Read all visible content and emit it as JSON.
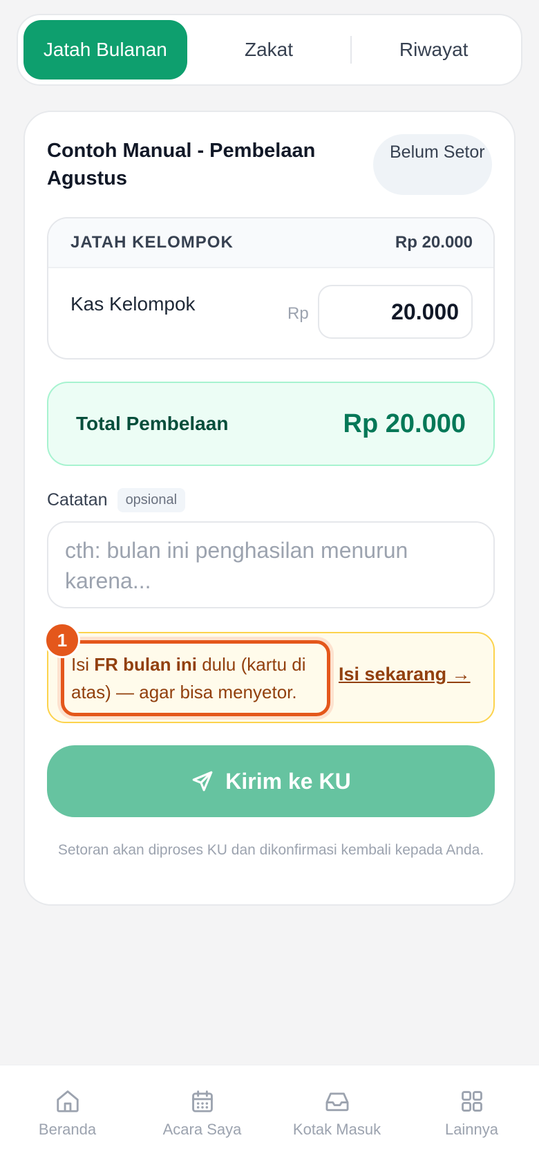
{
  "tabs": [
    {
      "label": "Jatah Bulanan",
      "active": true
    },
    {
      "label": "Zakat",
      "active": false
    },
    {
      "label": "Riwayat",
      "active": false
    }
  ],
  "card": {
    "title": "Contoh Manual - Pembelaan Agustus",
    "status": "Belum Setor",
    "group": {
      "header": "JATAH KELOMPOK",
      "header_amount": "Rp 20.000",
      "row_label": "Kas Kelompok",
      "currency": "Rp",
      "amount_value": "20.000"
    },
    "total": {
      "label": "Total Pembelaan",
      "value": "Rp 20.000"
    },
    "note": {
      "label": "Catatan",
      "optional": "opsional",
      "placeholder": "cth: bulan ini penghasilan menurun karena..."
    },
    "warning": {
      "badge": "1",
      "text_before": "Isi ",
      "text_bold": "FR bulan ini",
      "text_after": " dulu (kartu di atas) — agar bisa menyetor.",
      "link": "Isi sekarang →"
    },
    "submit_label": "Kirim ke KU",
    "footnote": "Setoran akan diproses KU dan dikonfirmasi kembali kepada Anda."
  },
  "nav": [
    {
      "label": "Beranda",
      "icon": "home-icon"
    },
    {
      "label": "Acara Saya",
      "icon": "calendar-icon"
    },
    {
      "label": "Kotak Masuk",
      "icon": "inbox-icon"
    },
    {
      "label": "Lainnya",
      "icon": "grid-icon"
    }
  ],
  "colors": {
    "primary": "#0e9f6e",
    "submit_disabled": "#66c3a0",
    "warning_accent": "#e4571b",
    "total_bg": "#ecfdf5"
  }
}
